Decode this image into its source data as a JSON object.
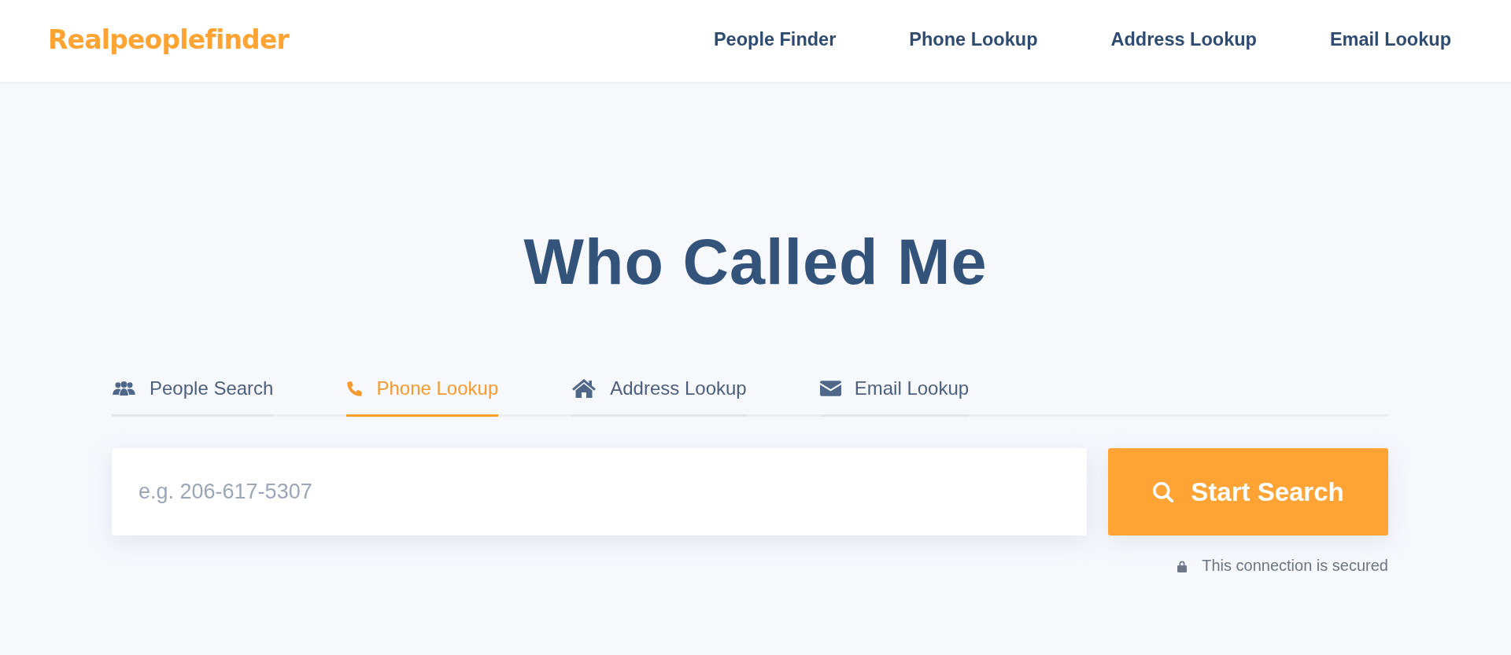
{
  "header": {
    "logo": "Realpeoplefinder",
    "nav": [
      {
        "label": "People Finder"
      },
      {
        "label": "Phone Lookup"
      },
      {
        "label": "Address Lookup"
      },
      {
        "label": "Email Lookup"
      }
    ]
  },
  "hero": {
    "title": "Who Called Me"
  },
  "search": {
    "tabs": [
      {
        "label": "People Search",
        "kind": "people",
        "selected": false
      },
      {
        "label": "Phone Lookup",
        "kind": "phone",
        "selected": true
      },
      {
        "label": "Address Lookup",
        "kind": "house",
        "selected": false
      },
      {
        "label": "Email Lookup",
        "kind": "envelope",
        "selected": false
      }
    ],
    "field": {
      "placeholder": "e.g. 206-617-5307"
    },
    "button": {
      "label": "Start Search"
    },
    "note": "This connection is secured"
  }
}
